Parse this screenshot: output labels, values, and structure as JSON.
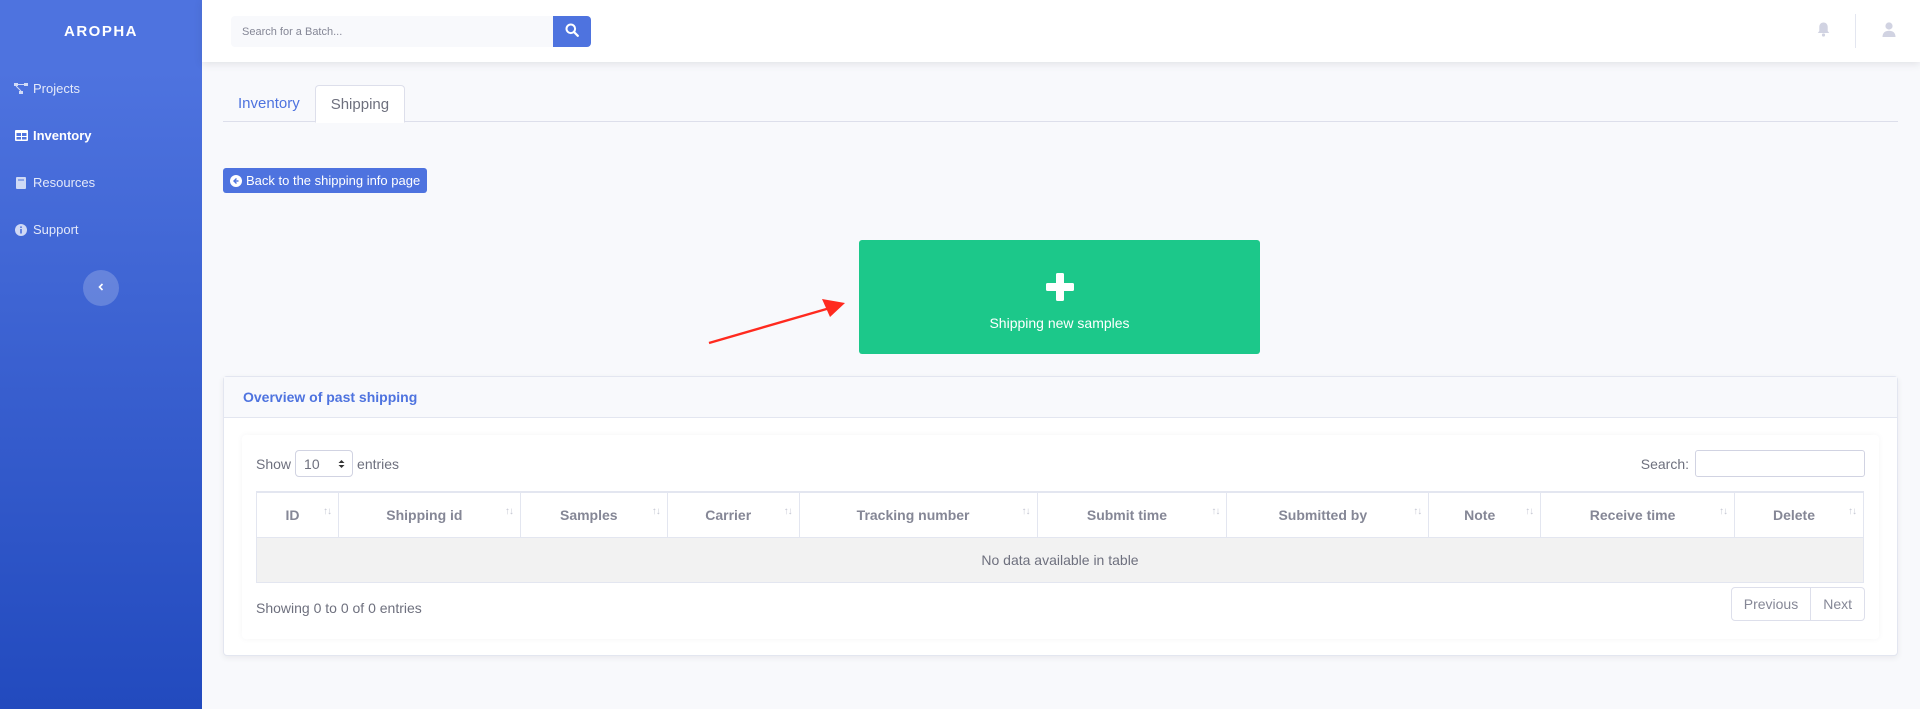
{
  "sidebar": {
    "brand": "AROPHA",
    "items": [
      {
        "label": "Projects",
        "icon": "project-diagram-icon",
        "active": false
      },
      {
        "label": "Inventory",
        "icon": "table-icon",
        "active": true
      },
      {
        "label": "Resources",
        "icon": "book-icon",
        "active": false
      },
      {
        "label": "Support",
        "icon": "info-circle-icon",
        "active": false
      }
    ],
    "toggle_icon": "chevron-left-icon"
  },
  "topbar": {
    "search_placeholder": "Search for a Batch...",
    "search_icon": "search-icon",
    "bell_icon": "bell-icon",
    "user_icon": "user-icon"
  },
  "tabs": [
    {
      "label": "Inventory",
      "active": false
    },
    {
      "label": "Shipping",
      "active": true
    }
  ],
  "back_button": {
    "label": "Back to the shipping info page",
    "icon": "arrow-circle-left-icon"
  },
  "ship_new": {
    "label": "Shipping new samples",
    "icon": "plus-icon"
  },
  "annotation": {
    "color": "#ff2a1f"
  },
  "overview": {
    "title": "Overview of past shipping",
    "show_label": "Show",
    "entries_label": "entries",
    "page_length": "10",
    "search_label": "Search:",
    "columns": [
      "ID",
      "Shipping id",
      "Samples",
      "Carrier",
      "Tracking number",
      "Submit time",
      "Submitted by",
      "Note",
      "Receive time",
      "Delete"
    ],
    "empty_message": "No data available in table",
    "info": "Showing 0 to 0 of 0 entries",
    "prev_label": "Previous",
    "next_label": "Next"
  },
  "colors": {
    "primary": "#4e73df",
    "success": "#1cc88a",
    "background": "#f8f9fc"
  }
}
